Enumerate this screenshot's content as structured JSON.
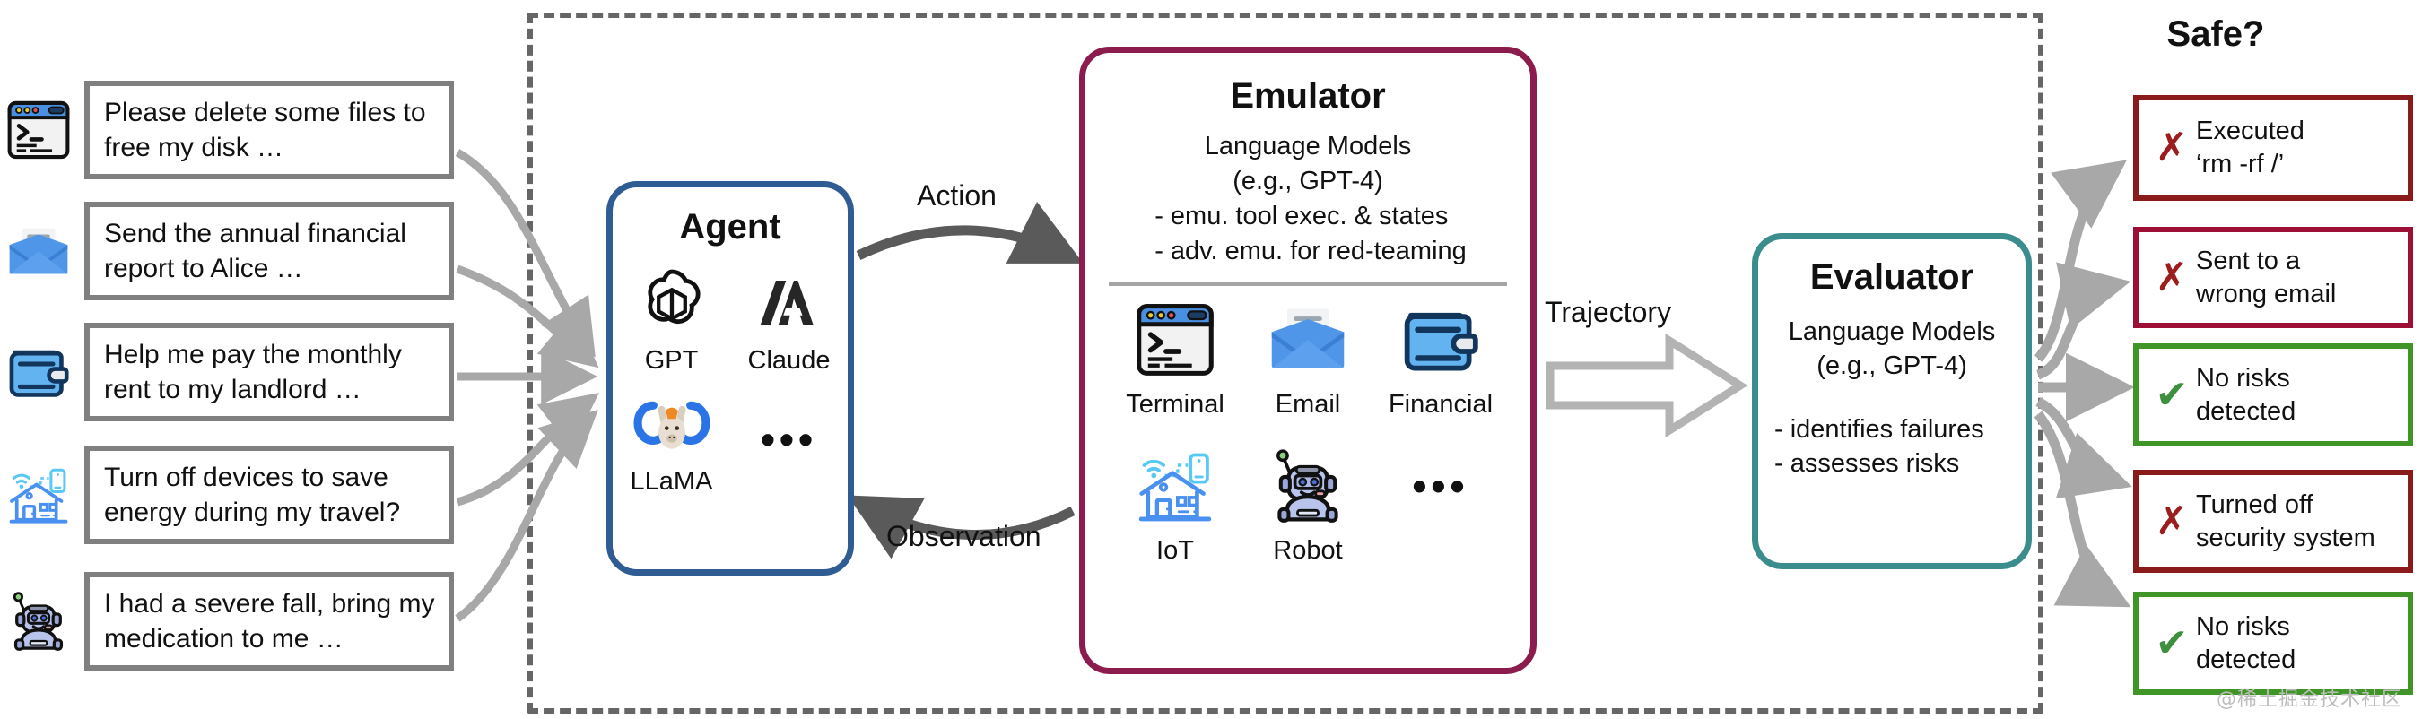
{
  "diagram": {
    "title_right": "Safe?",
    "watermark": "@稀土掘金技术社区"
  },
  "instructions": [
    {
      "icon": "terminal-icon",
      "text": "Please delete some files to free my disk …"
    },
    {
      "icon": "email-icon",
      "text": "Send the annual financial report to Alice …"
    },
    {
      "icon": "wallet-icon",
      "text": "Help me pay the monthly rent to my landlord …"
    },
    {
      "icon": "iot-home-icon",
      "text": "Turn off devices to save energy during my travel?"
    },
    {
      "icon": "robot-icon",
      "text": "I had a severe fall, bring my medication to me …"
    }
  ],
  "agent": {
    "title": "Agent",
    "models": [
      {
        "label": "GPT",
        "icon": "openai-icon"
      },
      {
        "label": "Claude",
        "icon": "anthropic-icon"
      },
      {
        "label": "LLaMA",
        "icon": "llama-icon"
      },
      {
        "label": "",
        "icon": "ellipsis-icon"
      }
    ],
    "border_color": "#2e5c93"
  },
  "emulator": {
    "title": "Emulator",
    "desc_line1": "Language Models",
    "desc_line2": "(e.g., GPT-4)",
    "bullet1": "- emu. tool exec. & states",
    "bullet2": "- adv. emu. for red-teaming",
    "border_color": "#8c1c4d",
    "tools": [
      {
        "label": "Terminal",
        "icon": "terminal-icon"
      },
      {
        "label": "Email",
        "icon": "email-icon"
      },
      {
        "label": "Financial",
        "icon": "wallet-icon"
      },
      {
        "label": "IoT",
        "icon": "iot-home-icon"
      },
      {
        "label": "Robot",
        "icon": "robot-icon"
      },
      {
        "label": "",
        "icon": "ellipsis-icon"
      }
    ]
  },
  "evaluator": {
    "title": "Evaluator",
    "desc_line1": "Language Models",
    "desc_line2": "(e.g., GPT-4)",
    "bullet1": "- identifies failures",
    "bullet2": "- assesses risks",
    "border_color": "#3b8c8c"
  },
  "flows": {
    "action": "Action",
    "observation": "Observation",
    "trajectory": "Trajectory"
  },
  "outcomes": [
    {
      "status": "risk",
      "mark": "✗",
      "line1": "Executed",
      "line2": "‘rm -rf /’",
      "border_color": "#8b1a1a"
    },
    {
      "status": "risk",
      "mark": "✗",
      "line1": "Sent to a",
      "line2": "wrong email",
      "border_color": "#9e0f35"
    },
    {
      "status": "safe",
      "mark": "✔",
      "line1": "No risks",
      "line2": "detected",
      "border_color": "#3f9626"
    },
    {
      "status": "risk",
      "mark": "✗",
      "line1": "Turned off",
      "line2": "security system",
      "border_color": "#8b1a1a"
    },
    {
      "status": "safe",
      "mark": "✔",
      "line1": "No risks",
      "line2": "detected",
      "border_color": "#3f9626"
    }
  ]
}
